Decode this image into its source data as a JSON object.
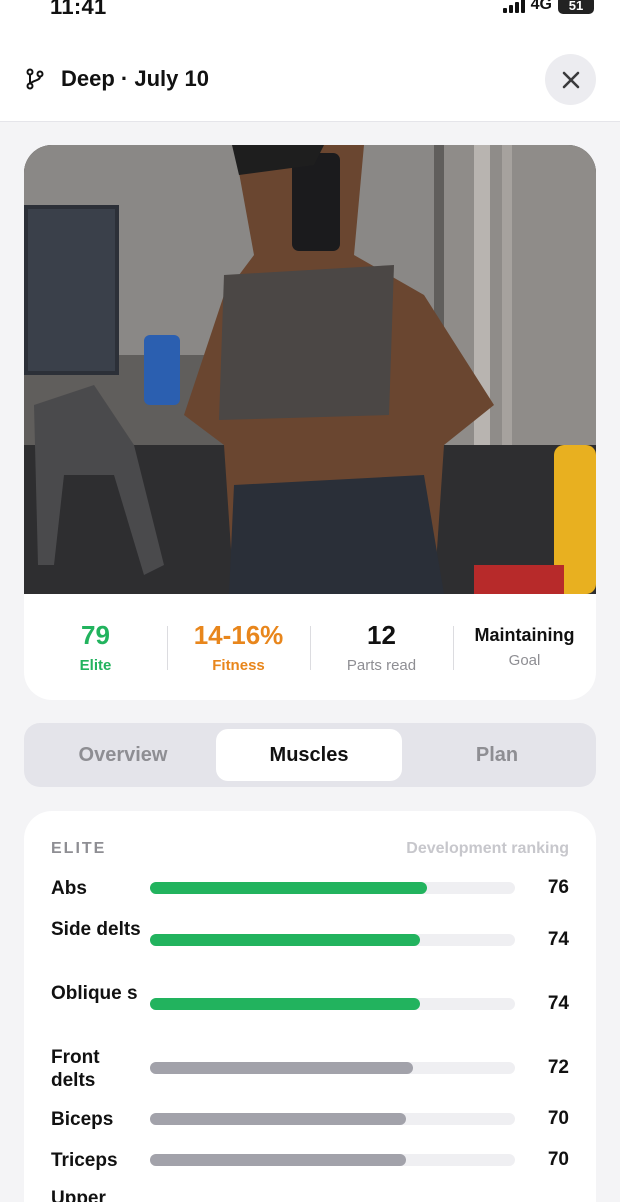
{
  "status": {
    "time": "11:41",
    "network": "4G",
    "battery": "51"
  },
  "header": {
    "title": "Deep · July 10",
    "branch_icon": "branch-icon",
    "close_icon": "close-icon"
  },
  "stats": [
    {
      "value": "79",
      "label": "Elite",
      "color": "#22b35e"
    },
    {
      "value": "14-16%",
      "label": "Fitness",
      "color": "#e8861c"
    },
    {
      "value": "12",
      "label": "Parts read",
      "color": "#111111"
    },
    {
      "value": "Maintaining",
      "label": "Goal",
      "color": "#111111"
    }
  ],
  "tabs": [
    {
      "label": "Overview",
      "active": false
    },
    {
      "label": "Muscles",
      "active": true
    },
    {
      "label": "Plan",
      "active": false
    }
  ],
  "muscles": {
    "tier": "ELITE",
    "header": "Development ranking",
    "colors": {
      "green": "#22b35e",
      "gray": "#a2a2aa"
    },
    "items": [
      {
        "name": "Abs",
        "value": "76",
        "score": 76,
        "color": "green"
      },
      {
        "name": "Side delts",
        "value": "74",
        "score": 74,
        "color": "green"
      },
      {
        "name": "Oblique s",
        "value": "74",
        "score": 74,
        "color": "green"
      },
      {
        "name": "Front delts",
        "value": "72",
        "score": 72,
        "color": "gray"
      },
      {
        "name": "Biceps",
        "value": "70",
        "score": 70,
        "color": "gray"
      },
      {
        "name": "Triceps",
        "value": "70",
        "score": 70,
        "color": "gray"
      },
      {
        "name": "Upper",
        "value": "",
        "score": null,
        "color": "gray"
      }
    ]
  }
}
